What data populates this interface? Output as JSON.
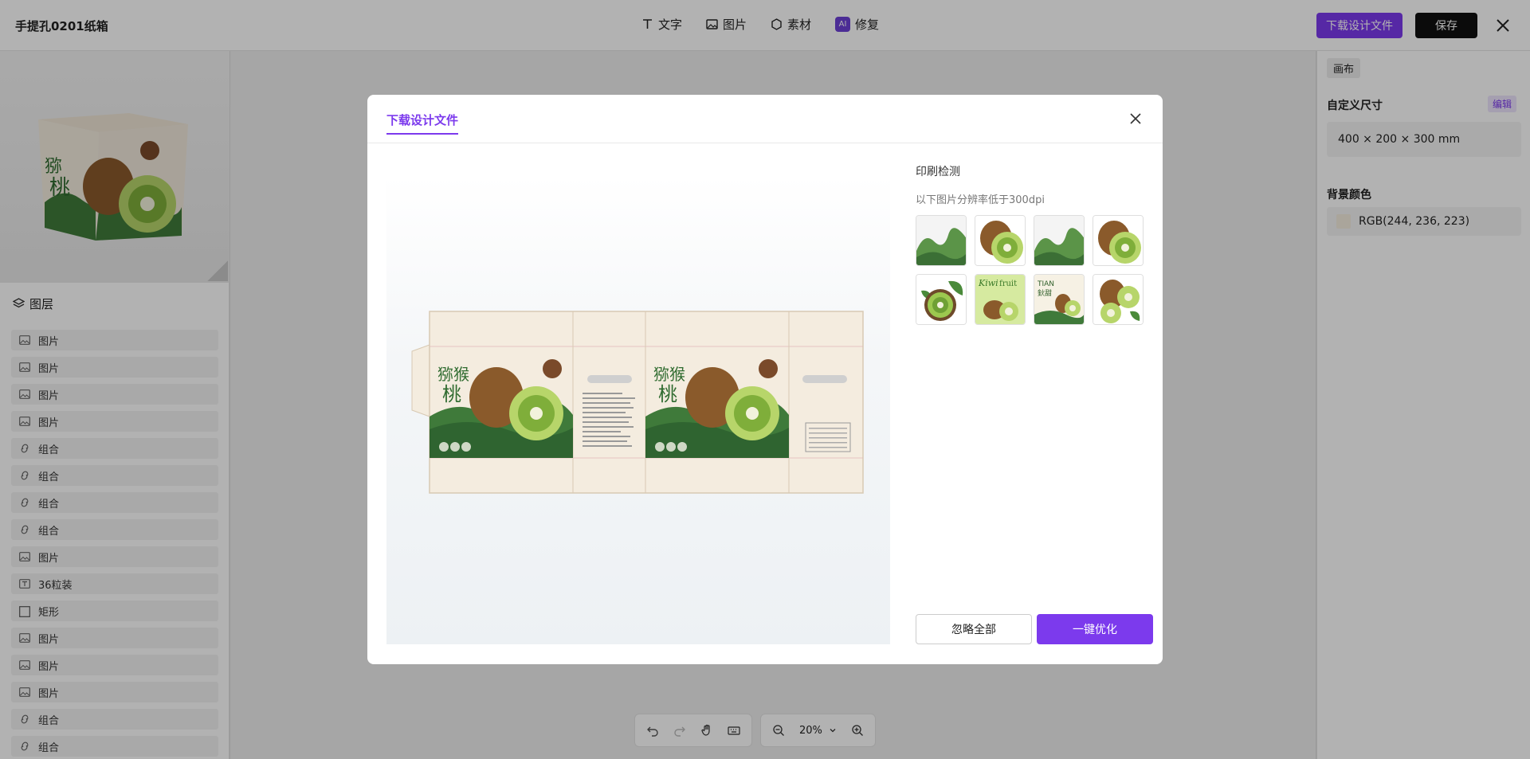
{
  "app": {
    "doc_title": "手提孔0201纸箱",
    "tools": [
      {
        "label": "文字",
        "icon": "text-icon"
      },
      {
        "label": "图片",
        "icon": "image-icon"
      },
      {
        "label": "素材",
        "icon": "hexagon-icon"
      },
      {
        "label": "修复",
        "icon": "ai-icon",
        "badge": "AI"
      }
    ],
    "download_label": "下载设计文件",
    "save_label": "保存"
  },
  "layers_panel": {
    "title": "图层",
    "items": [
      {
        "label": "图片",
        "icon": "image-icon"
      },
      {
        "label": "图片",
        "icon": "image-icon"
      },
      {
        "label": "图片",
        "icon": "image-icon"
      },
      {
        "label": "图片",
        "icon": "image-icon"
      },
      {
        "label": "组合",
        "icon": "group-icon"
      },
      {
        "label": "组合",
        "icon": "group-icon"
      },
      {
        "label": "组合",
        "icon": "group-icon"
      },
      {
        "label": "组合",
        "icon": "group-icon"
      },
      {
        "label": "图片",
        "icon": "image-icon"
      },
      {
        "label": "36粒装",
        "icon": "text-icon"
      },
      {
        "label": "矩形",
        "icon": "rect-icon"
      },
      {
        "label": "图片",
        "icon": "image-icon"
      },
      {
        "label": "图片",
        "icon": "image-icon"
      },
      {
        "label": "图片",
        "icon": "image-icon"
      },
      {
        "label": "组合",
        "icon": "group-icon"
      },
      {
        "label": "组合",
        "icon": "group-icon"
      }
    ]
  },
  "right_panel": {
    "tab": "画布",
    "size_label": "自定义尺寸",
    "edit_label": "编辑",
    "size_value": "400 × 200 × 300 mm",
    "bg_label": "背景颜色",
    "bg_value": "RGB(244, 236, 223)",
    "bg_color": "#f4ecdf"
  },
  "bottom_bar": {
    "zoom": "20%"
  },
  "dialog": {
    "tab": "下载设计文件",
    "check_title": "印刷检测",
    "check_subtitle": "以下图片分辨率低于300dpi",
    "thumbnails": [
      "mountain",
      "kiwi-half",
      "mountain",
      "kiwi-half",
      "kiwi-leaf",
      "kiwi-fruit-label",
      "tian-label",
      "kiwi-pair"
    ],
    "ignore_label": "忽略全部",
    "optimize_label": "一键优化",
    "accent": "#7c3aed"
  }
}
